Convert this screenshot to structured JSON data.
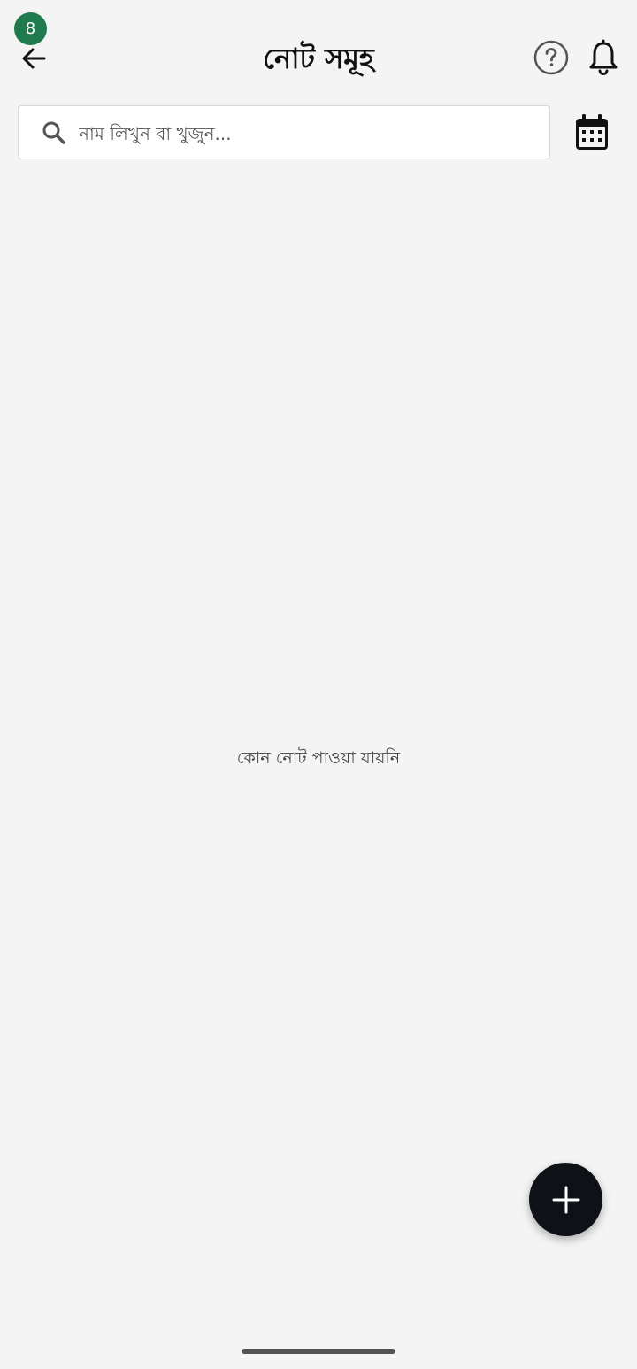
{
  "status": {
    "badge_count": "8"
  },
  "header": {
    "title": "নোট সমূহ",
    "back_icon": "arrow-left-icon",
    "help_icon": "help-circle-icon",
    "bell_icon": "bell-icon"
  },
  "search": {
    "placeholder": "নাম লিখুন বা খুজুন...",
    "value": "",
    "icon": "search-icon"
  },
  "calendar": {
    "icon": "calendar-icon"
  },
  "main": {
    "empty_message": "কোন নোট পাওয়া যায়নি"
  },
  "fab": {
    "icon": "plus-icon"
  },
  "colors": {
    "background": "#f4f4f4",
    "badge": "#1f7a4d",
    "fab": "#0e1116"
  }
}
